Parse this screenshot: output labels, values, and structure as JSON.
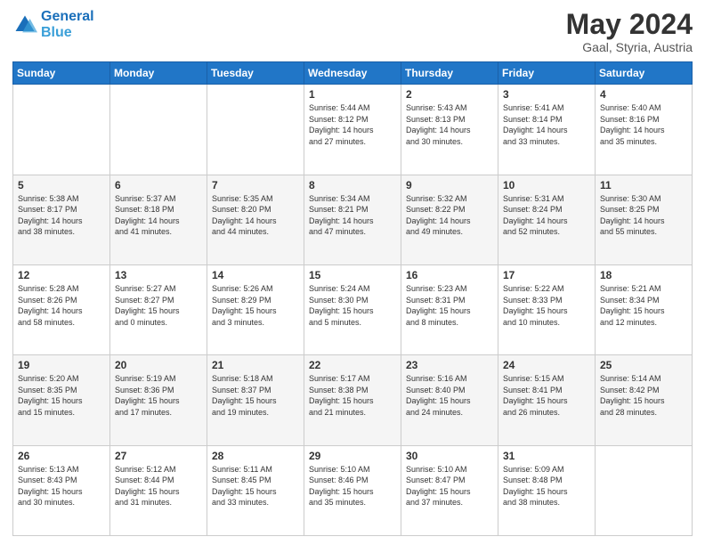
{
  "header": {
    "logo_line1": "General",
    "logo_line2": "Blue",
    "month": "May 2024",
    "location": "Gaal, Styria, Austria"
  },
  "days_of_week": [
    "Sunday",
    "Monday",
    "Tuesday",
    "Wednesday",
    "Thursday",
    "Friday",
    "Saturday"
  ],
  "weeks": [
    [
      {
        "day": "",
        "info": ""
      },
      {
        "day": "",
        "info": ""
      },
      {
        "day": "",
        "info": ""
      },
      {
        "day": "1",
        "info": "Sunrise: 5:44 AM\nSunset: 8:12 PM\nDaylight: 14 hours\nand 27 minutes."
      },
      {
        "day": "2",
        "info": "Sunrise: 5:43 AM\nSunset: 8:13 PM\nDaylight: 14 hours\nand 30 minutes."
      },
      {
        "day": "3",
        "info": "Sunrise: 5:41 AM\nSunset: 8:14 PM\nDaylight: 14 hours\nand 33 minutes."
      },
      {
        "day": "4",
        "info": "Sunrise: 5:40 AM\nSunset: 8:16 PM\nDaylight: 14 hours\nand 35 minutes."
      }
    ],
    [
      {
        "day": "5",
        "info": "Sunrise: 5:38 AM\nSunset: 8:17 PM\nDaylight: 14 hours\nand 38 minutes."
      },
      {
        "day": "6",
        "info": "Sunrise: 5:37 AM\nSunset: 8:18 PM\nDaylight: 14 hours\nand 41 minutes."
      },
      {
        "day": "7",
        "info": "Sunrise: 5:35 AM\nSunset: 8:20 PM\nDaylight: 14 hours\nand 44 minutes."
      },
      {
        "day": "8",
        "info": "Sunrise: 5:34 AM\nSunset: 8:21 PM\nDaylight: 14 hours\nand 47 minutes."
      },
      {
        "day": "9",
        "info": "Sunrise: 5:32 AM\nSunset: 8:22 PM\nDaylight: 14 hours\nand 49 minutes."
      },
      {
        "day": "10",
        "info": "Sunrise: 5:31 AM\nSunset: 8:24 PM\nDaylight: 14 hours\nand 52 minutes."
      },
      {
        "day": "11",
        "info": "Sunrise: 5:30 AM\nSunset: 8:25 PM\nDaylight: 14 hours\nand 55 minutes."
      }
    ],
    [
      {
        "day": "12",
        "info": "Sunrise: 5:28 AM\nSunset: 8:26 PM\nDaylight: 14 hours\nand 58 minutes."
      },
      {
        "day": "13",
        "info": "Sunrise: 5:27 AM\nSunset: 8:27 PM\nDaylight: 15 hours\nand 0 minutes."
      },
      {
        "day": "14",
        "info": "Sunrise: 5:26 AM\nSunset: 8:29 PM\nDaylight: 15 hours\nand 3 minutes."
      },
      {
        "day": "15",
        "info": "Sunrise: 5:24 AM\nSunset: 8:30 PM\nDaylight: 15 hours\nand 5 minutes."
      },
      {
        "day": "16",
        "info": "Sunrise: 5:23 AM\nSunset: 8:31 PM\nDaylight: 15 hours\nand 8 minutes."
      },
      {
        "day": "17",
        "info": "Sunrise: 5:22 AM\nSunset: 8:33 PM\nDaylight: 15 hours\nand 10 minutes."
      },
      {
        "day": "18",
        "info": "Sunrise: 5:21 AM\nSunset: 8:34 PM\nDaylight: 15 hours\nand 12 minutes."
      }
    ],
    [
      {
        "day": "19",
        "info": "Sunrise: 5:20 AM\nSunset: 8:35 PM\nDaylight: 15 hours\nand 15 minutes."
      },
      {
        "day": "20",
        "info": "Sunrise: 5:19 AM\nSunset: 8:36 PM\nDaylight: 15 hours\nand 17 minutes."
      },
      {
        "day": "21",
        "info": "Sunrise: 5:18 AM\nSunset: 8:37 PM\nDaylight: 15 hours\nand 19 minutes."
      },
      {
        "day": "22",
        "info": "Sunrise: 5:17 AM\nSunset: 8:38 PM\nDaylight: 15 hours\nand 21 minutes."
      },
      {
        "day": "23",
        "info": "Sunrise: 5:16 AM\nSunset: 8:40 PM\nDaylight: 15 hours\nand 24 minutes."
      },
      {
        "day": "24",
        "info": "Sunrise: 5:15 AM\nSunset: 8:41 PM\nDaylight: 15 hours\nand 26 minutes."
      },
      {
        "day": "25",
        "info": "Sunrise: 5:14 AM\nSunset: 8:42 PM\nDaylight: 15 hours\nand 28 minutes."
      }
    ],
    [
      {
        "day": "26",
        "info": "Sunrise: 5:13 AM\nSunset: 8:43 PM\nDaylight: 15 hours\nand 30 minutes."
      },
      {
        "day": "27",
        "info": "Sunrise: 5:12 AM\nSunset: 8:44 PM\nDaylight: 15 hours\nand 31 minutes."
      },
      {
        "day": "28",
        "info": "Sunrise: 5:11 AM\nSunset: 8:45 PM\nDaylight: 15 hours\nand 33 minutes."
      },
      {
        "day": "29",
        "info": "Sunrise: 5:10 AM\nSunset: 8:46 PM\nDaylight: 15 hours\nand 35 minutes."
      },
      {
        "day": "30",
        "info": "Sunrise: 5:10 AM\nSunset: 8:47 PM\nDaylight: 15 hours\nand 37 minutes."
      },
      {
        "day": "31",
        "info": "Sunrise: 5:09 AM\nSunset: 8:48 PM\nDaylight: 15 hours\nand 38 minutes."
      },
      {
        "day": "",
        "info": ""
      }
    ]
  ]
}
